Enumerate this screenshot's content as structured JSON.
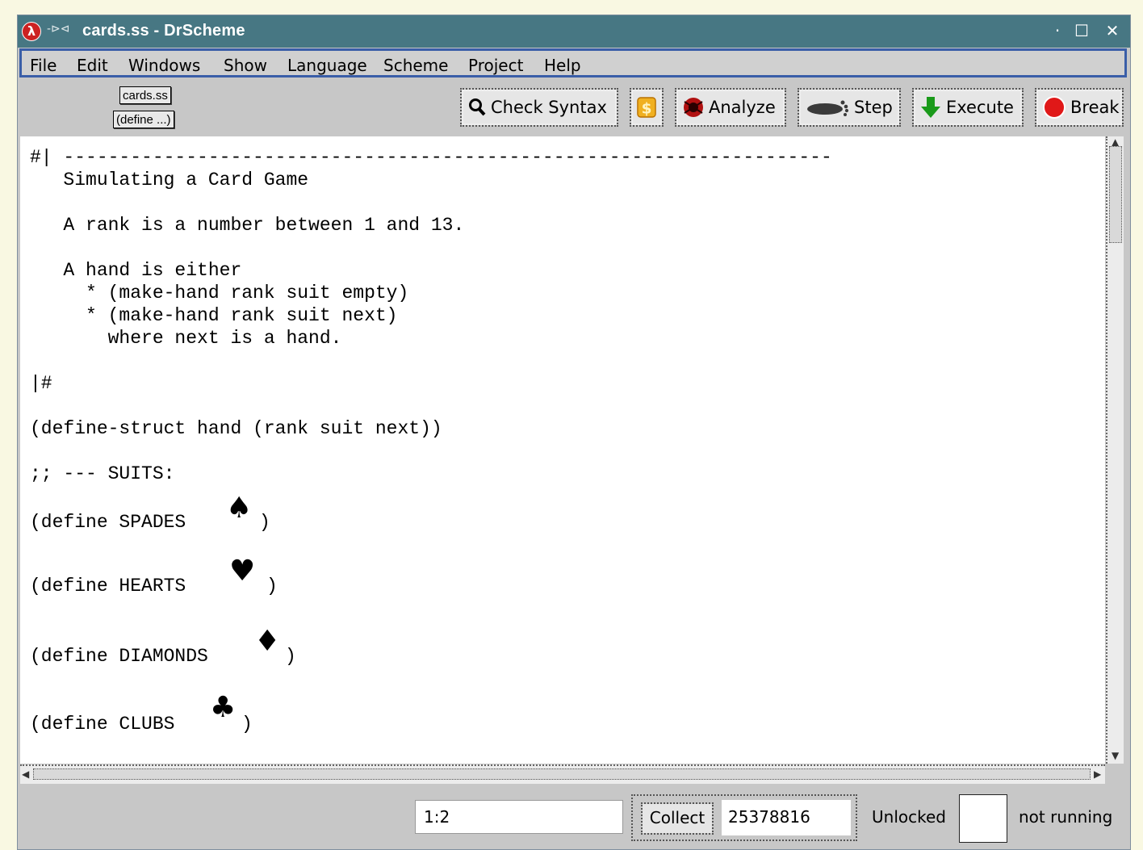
{
  "window": {
    "title": "cards.ss - DrScheme",
    "logo_icon": "lambda-logo-icon",
    "pin_glyph": "-⊳⊲",
    "controls": [
      "·",
      "☐",
      "✕"
    ]
  },
  "menubar": {
    "items": [
      "File",
      "Edit",
      "Windows",
      "Show",
      "Language",
      "Scheme",
      "Project",
      "Help"
    ]
  },
  "toolbar": {
    "file_label": "cards.ss",
    "define_label": "(define ...)",
    "buttons": {
      "check_syntax": "Check Syntax",
      "analyze": "Analyze",
      "step": "Step",
      "execute": "Execute",
      "break": "Break"
    },
    "icons": {
      "check_syntax": "magnifier-icon",
      "money": "dollar-icon",
      "analyze": "spider-icon",
      "step": "foot-icon",
      "execute": "down-arrow-icon",
      "break": "stop-icon"
    }
  },
  "editor": {
    "comment_block": "#| ---------------------------------------------------------------------\n   Simulating a Card Game\n\n   A rank is a number between 1 and 13.\n\n   A hand is either\n     * (make-hand rank suit empty)\n     * (make-hand rank suit next)\n       where next is a hand.\n\n|#\n\n(define-struct hand (rank suit next))\n\n;; --- SUITS:",
    "suits": [
      {
        "prefix": "(define SPADES ",
        "glyph": "♠",
        "suffix": ")"
      },
      {
        "prefix": "(define HEARTS ",
        "glyph": "♥",
        "suffix": ")"
      },
      {
        "prefix": "(define DIAMONDS ",
        "glyph": "♦",
        "suffix": ")"
      },
      {
        "prefix": "(define CLUBS ",
        "glyph": "♣",
        "suffix": ")"
      }
    ]
  },
  "statusbar": {
    "position": "1:2",
    "collect_label": "Collect",
    "memory": "25378816",
    "lock_status": "Unlocked",
    "run_status": "not running"
  },
  "colors": {
    "titlebar": "#477783",
    "menubar_border": "#3a5ea8",
    "chrome": "#c7c7c7"
  }
}
